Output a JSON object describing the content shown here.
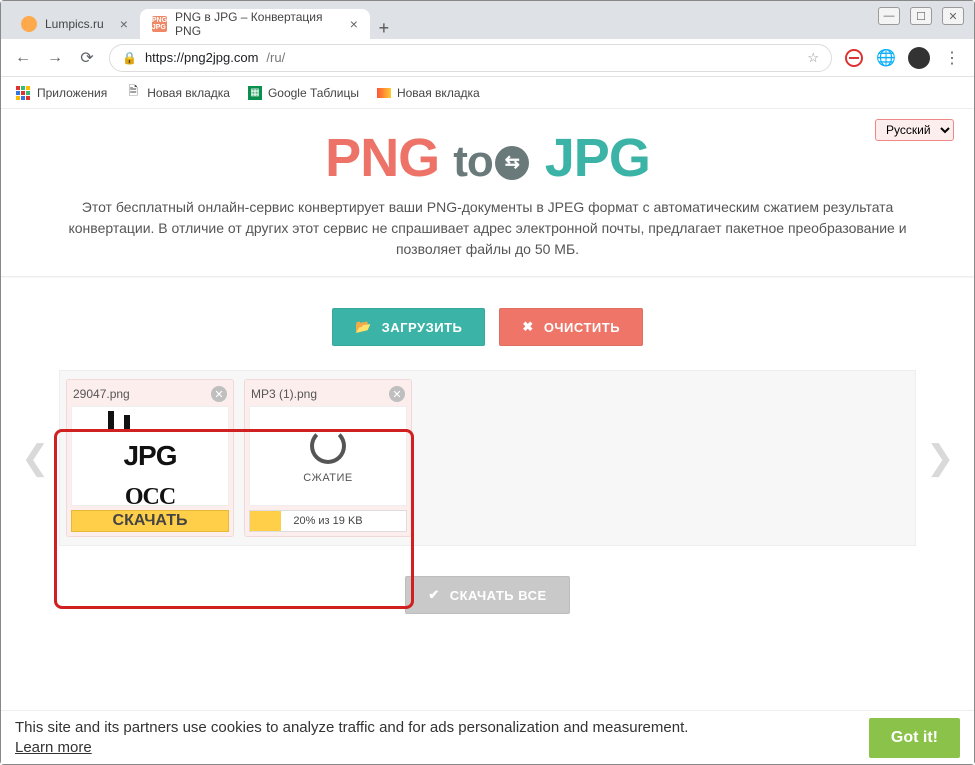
{
  "tabs": [
    {
      "title": "Lumpics.ru",
      "active": false
    },
    {
      "title": "PNG в JPG – Конвертация PNG ",
      "active": true
    }
  ],
  "url": {
    "host": "https://png2jpg.com",
    "path": "/ru/"
  },
  "bookmarks": {
    "apps": "Приложения",
    "items": [
      {
        "label": "Новая вкладка"
      },
      {
        "label": "Google Таблицы"
      },
      {
        "label": "Новая вкладка"
      }
    ]
  },
  "lang": {
    "selected": "Русский"
  },
  "logo": {
    "p1": "PNG",
    "p2": "to",
    "p3": "JPG"
  },
  "description": "Этот бесплатный онлайн-сервис конвертирует ваши PNG-документы в JPEG формат с автоматическим сжатием результата конвертации. В отличие от других этот сервис не спрашивает адрес электронной почты, предлагает пакетное преобразование и позволяет файлы до 50 МБ.",
  "buttons": {
    "upload": "ЗАГРУЗИТЬ",
    "clear": "ОЧИСТИТЬ",
    "download_all": "СКАЧАТЬ ВСЕ"
  },
  "files": [
    {
      "name": "29047.png",
      "state": "done",
      "thumb_text": "JPG",
      "action_label": "СКАЧАТЬ"
    },
    {
      "name": "MP3 (1).png",
      "state": "compressing",
      "status_label": "СЖАТИЕ",
      "progress_percent": 20,
      "progress_text": "20% из 19 KB"
    }
  ],
  "cookie": {
    "text": "This site and its partners use cookies to analyze traffic and for ads personalization and measurement.",
    "learn": "Learn more",
    "ok": "Got it!"
  }
}
